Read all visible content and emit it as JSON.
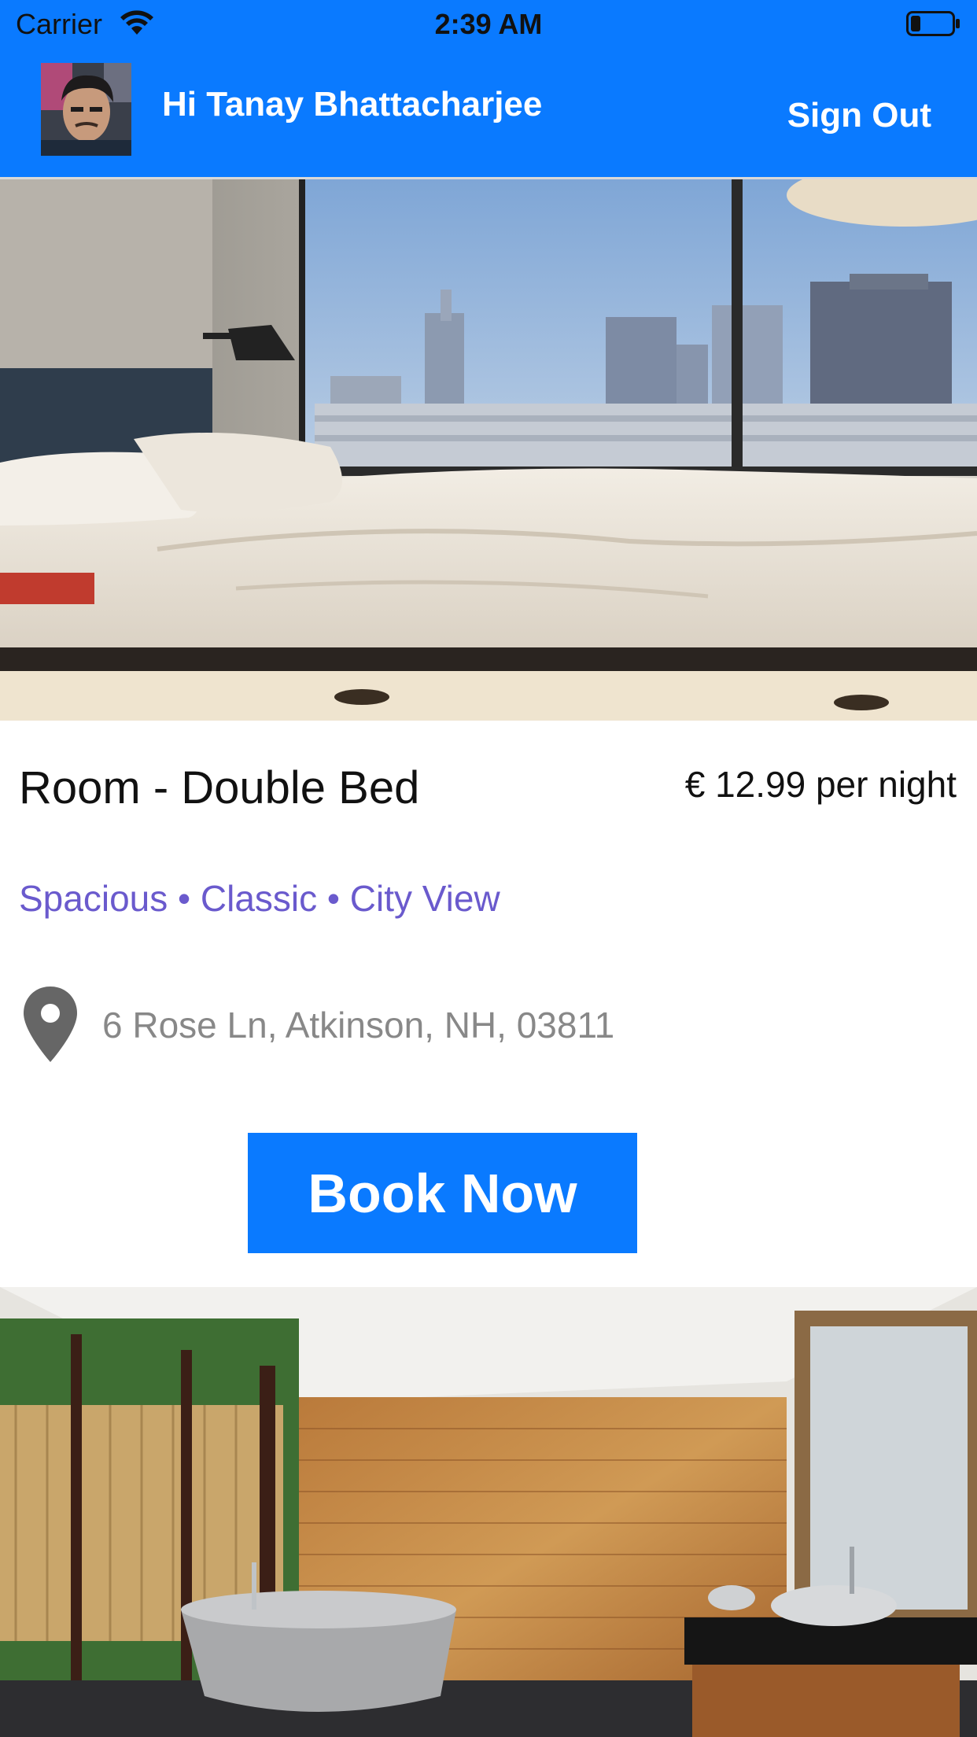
{
  "status_bar": {
    "carrier": "Carrier",
    "time": "2:39 AM",
    "wifi_icon": "wifi-icon",
    "battery_icon": "battery-icon"
  },
  "header": {
    "greeting": "Hi Tanay Bhattacharjee",
    "sign_out_label": "Sign Out",
    "background_color": "#0a7aff",
    "avatar_icon": "user-avatar"
  },
  "listing": {
    "title": "Room - Double Bed",
    "price": "€ 12.99 per night",
    "tags": "Spacious • Classic • City View",
    "address": "6 Rose Ln, Atkinson, NH, 03811",
    "location_icon": "map-pin-icon",
    "tag_color": "#6a5acd",
    "book_label": "Book Now"
  },
  "images": {
    "hero_room": "bedroom-city-view-photo",
    "next_listing": "bathroom-wood-panel-photo"
  }
}
